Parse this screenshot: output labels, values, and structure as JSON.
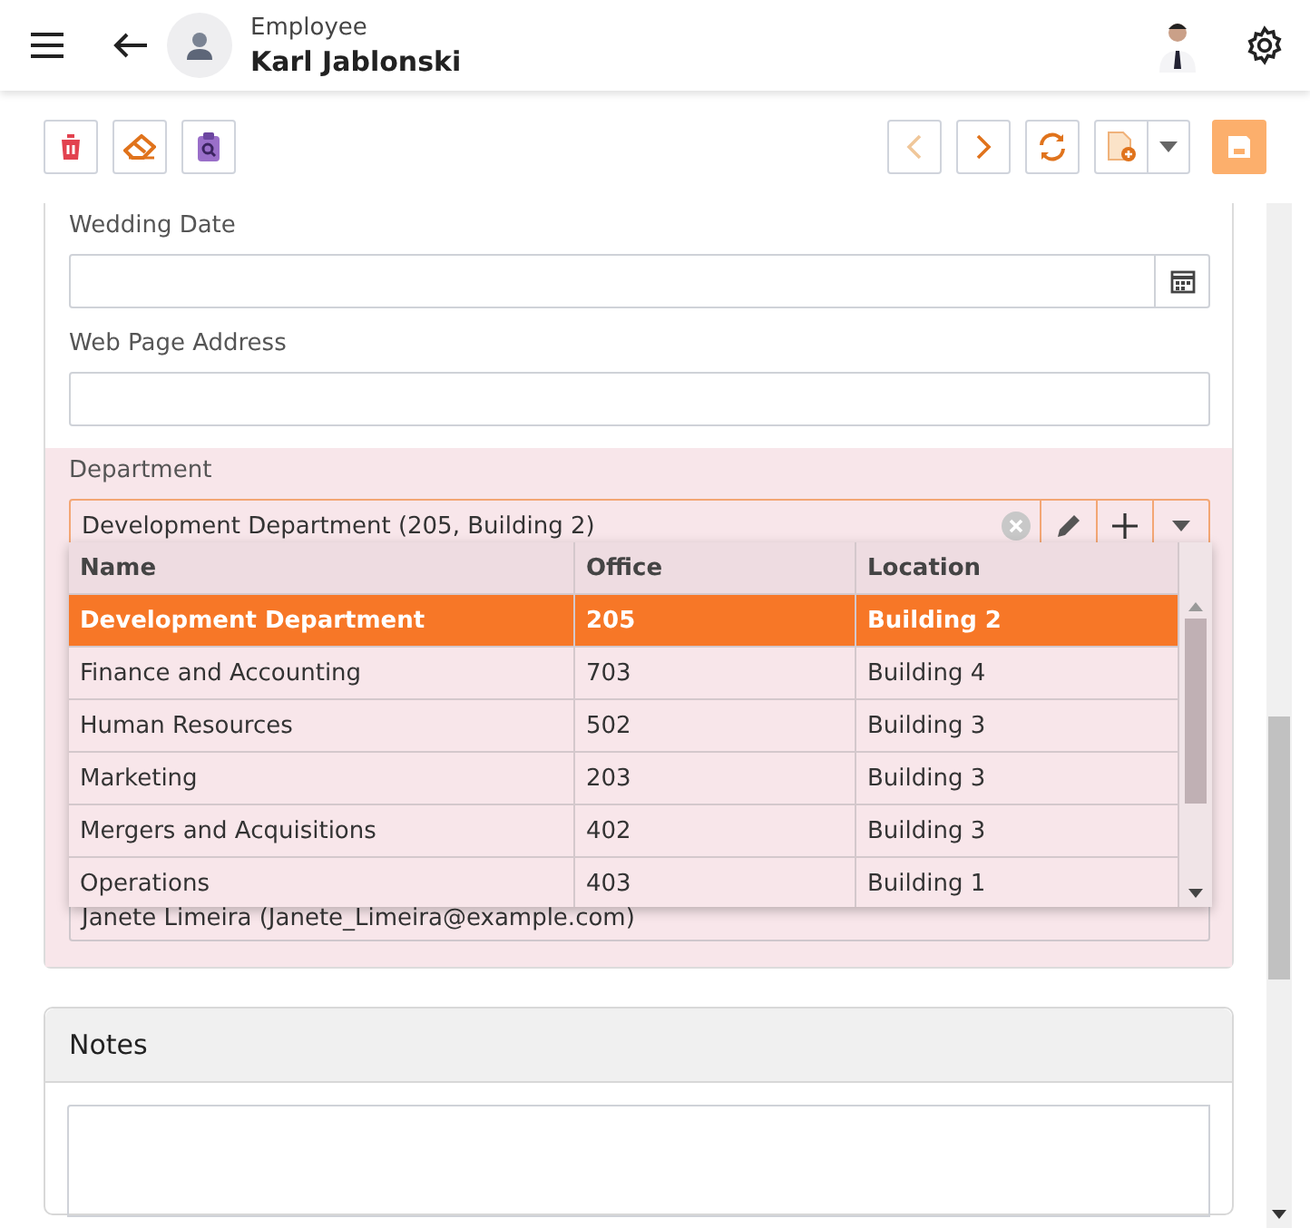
{
  "header": {
    "subtitle": "Employee",
    "title": "Karl Jablonski"
  },
  "fields": [
    {
      "label": "Wedding Date",
      "kind": "date"
    },
    {
      "label": "Web Page Address",
      "kind": "text"
    }
  ],
  "department": {
    "label": "Department",
    "value": "Development Department (205, Building 2)",
    "columns": [
      "Name",
      "Office",
      "Location"
    ],
    "rows": [
      {
        "cells": [
          "Development Department",
          "205",
          "Building 2"
        ],
        "selected": true
      },
      {
        "cells": [
          "Finance and Accounting",
          "703",
          "Building 4"
        ],
        "selected": false
      },
      {
        "cells": [
          "Human Resources",
          "502",
          "Building 3"
        ],
        "selected": false
      },
      {
        "cells": [
          "Marketing",
          "203",
          "Building 3"
        ],
        "selected": false
      },
      {
        "cells": [
          "Mergers and Acquisitions",
          "402",
          "Building 3"
        ],
        "selected": false
      },
      {
        "cells": [
          "Operations",
          "403",
          "Building 1"
        ],
        "selected": false
      }
    ]
  },
  "manager": {
    "value": "Janete Limeira (Janete_Limeira@example.com)"
  },
  "notes": {
    "title": "Notes"
  }
}
